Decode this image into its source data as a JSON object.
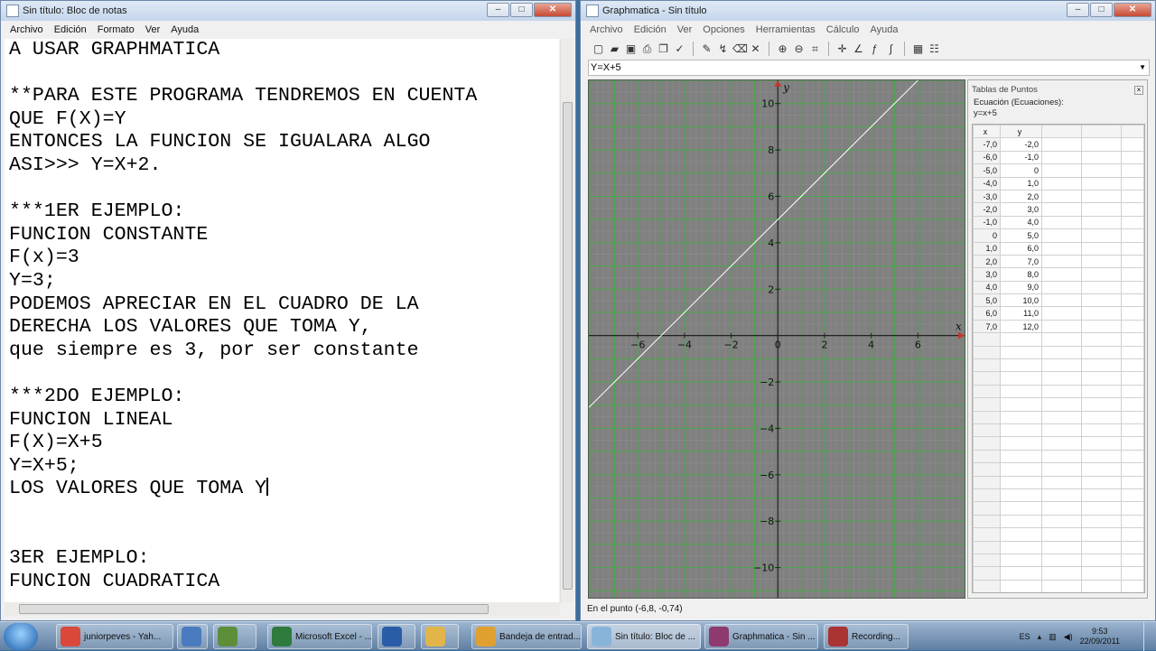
{
  "notepad": {
    "title": "Sin título: Bloc de notas",
    "menu": [
      "Archivo",
      "Edición",
      "Formato",
      "Ver",
      "Ayuda"
    ],
    "lines": [
      "A USAR GRAPHMATICA",
      "",
      "**PARA ESTE PROGRAMA TENDREMOS EN CUENTA",
      "QUE F(X)=Y",
      "ENTONCES LA FUNCION SE IGUALARA ALGO",
      "ASI>>> Y=X+2.",
      "",
      "***1ER EJEMPLO:",
      "FUNCION CONSTANTE",
      "F(x)=3",
      "Y=3;",
      "PODEMOS APRECIAR EN EL CUADRO DE LA",
      "DERECHA LOS VALORES QUE TOMA Y,",
      "que siempre es 3, por ser constante",
      "",
      "***2DO EJEMPLO:",
      "FUNCION LINEAL",
      "F(X)=X+5",
      "Y=X+5;",
      "LOS VALORES QUE TOMA Y",
      "",
      "",
      "3ER EJEMPLO:",
      "FUNCION CUADRATICA"
    ]
  },
  "graphmatica": {
    "title": "Graphmatica - Sin título",
    "menu": [
      "Archivo",
      "Edición",
      "Ver",
      "Opciones",
      "Herramientas",
      "Cálculo",
      "Ayuda"
    ],
    "equation": "Y=X+5",
    "status": "En el punto (-6,8, -0,74)",
    "points_panel": {
      "title": "Tablas de Puntos",
      "subtitle": "Ecuación (Ecuaciones):",
      "equation": "y=x+5",
      "col_x": "x",
      "col_y": "y",
      "rows": [
        [
          "-7,0",
          "-2,0"
        ],
        [
          "-6,0",
          "-1,0"
        ],
        [
          "-5,0",
          "0"
        ],
        [
          "-4,0",
          "1,0"
        ],
        [
          "-3,0",
          "2,0"
        ],
        [
          "-2,0",
          "3,0"
        ],
        [
          "-1,0",
          "4,0"
        ],
        [
          "0",
          "5,0"
        ],
        [
          "1,0",
          "6,0"
        ],
        [
          "2,0",
          "7,0"
        ],
        [
          "3,0",
          "8,0"
        ],
        [
          "4,0",
          "9,0"
        ],
        [
          "5,0",
          "10,0"
        ],
        [
          "6,0",
          "11,0"
        ],
        [
          "7,0",
          "12,0"
        ]
      ]
    }
  },
  "chart_data": {
    "type": "line",
    "series": [
      {
        "name": "y=x+5",
        "slope": 1,
        "intercept": 5
      }
    ],
    "xlabel": "x",
    "ylabel": "y",
    "xlim": [
      -8.1,
      8.0
    ],
    "ylim": [
      -11.3,
      11.0
    ],
    "x_ticks": [
      -6,
      -4,
      -2,
      0,
      2,
      4,
      6
    ],
    "y_ticks": [
      -10,
      -8,
      -6,
      -4,
      -2,
      2,
      4,
      6,
      8,
      10
    ],
    "grid": true,
    "colors": {
      "background": "#808080",
      "major_grid": "#4aa84a",
      "minor_grid": "#8f8f8f",
      "line": "#ffffff"
    }
  },
  "taskbar": {
    "items": [
      {
        "label": "juniorpeves - Yah...",
        "icon": "chrome-icon"
      },
      {
        "label": "",
        "icon": "mail-client-icon"
      },
      {
        "label": "",
        "icon": "network-icon"
      },
      {
        "label": "Microsoft Excel - ...",
        "icon": "excel-icon"
      },
      {
        "label": "",
        "icon": "word-icon"
      },
      {
        "label": "",
        "icon": "folder-icon"
      },
      {
        "label": "Bandeja de entrad...",
        "icon": "outlook-icon"
      },
      {
        "label": "Sin título: Bloc de ...",
        "icon": "notepad-icon"
      },
      {
        "label": "Graphmatica - Sin ...",
        "icon": "graphmatica-icon"
      },
      {
        "label": "Recording...",
        "icon": "recorder-icon"
      }
    ],
    "language": "ES",
    "time": "9:53",
    "date": "22/09/2011"
  }
}
